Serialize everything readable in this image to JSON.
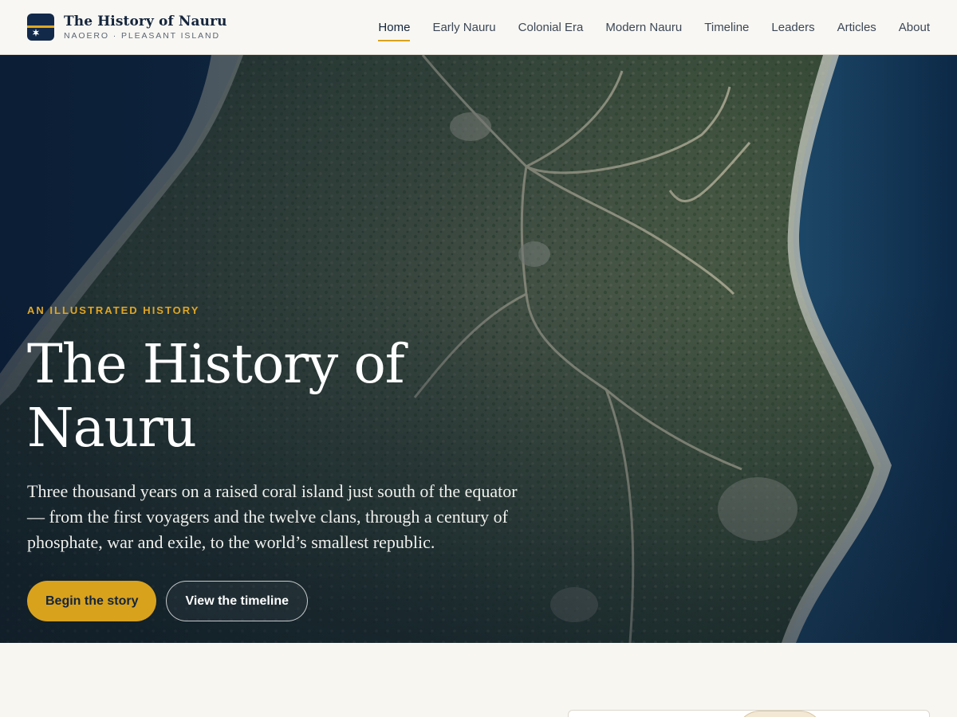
{
  "header": {
    "brand_title": "The History of Nauru",
    "brand_subtitle": "NAOERO · PLEASANT ISLAND",
    "nav": [
      {
        "label": "Home",
        "active": true
      },
      {
        "label": "Early Nauru",
        "active": false
      },
      {
        "label": "Colonial Era",
        "active": false
      },
      {
        "label": "Modern Nauru",
        "active": false
      },
      {
        "label": "Timeline",
        "active": false
      },
      {
        "label": "Leaders",
        "active": false
      },
      {
        "label": "Articles",
        "active": false
      },
      {
        "label": "About",
        "active": false
      }
    ]
  },
  "hero": {
    "eyebrow": "AN ILLUSTRATED HISTORY",
    "title": "The History of Nauru",
    "lede": "Three thousand years on a raised coral island just south of the equator — from the first voyagers and the twelve clans, through a century of phosphate, war and exile, to the world’s smallest republic.",
    "primary_button": "Begin the story",
    "secondary_button": "View the timeline",
    "background_image": "aerial-satellite-photo-of-island-coast"
  },
  "colors": {
    "navy": "#12294a",
    "gold": "#d9a21c",
    "page_bg": "#f8f6f1"
  }
}
